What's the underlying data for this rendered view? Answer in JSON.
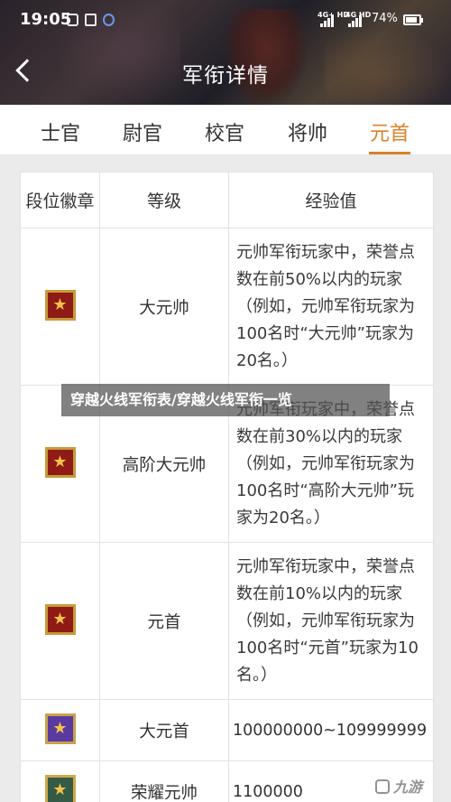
{
  "status_bar": {
    "time": "19:05",
    "network_1": "4G+ HD",
    "network_2": "4G HD",
    "battery": "74%"
  },
  "header": {
    "title": "军衔详情",
    "back_icon": "chevron-left-icon"
  },
  "tabs": [
    {
      "label": "士官",
      "active": false
    },
    {
      "label": "尉官",
      "active": false
    },
    {
      "label": "校官",
      "active": false
    },
    {
      "label": "将帅",
      "active": false
    },
    {
      "label": "元首",
      "active": true
    }
  ],
  "accent_color": "#d9822b",
  "table": {
    "columns": [
      "段位徽章",
      "等级",
      "经验值"
    ],
    "rows": [
      {
        "badge_icon": "rank-badge-red-star-icon",
        "level": "大元帅",
        "exp": "元帅军衔玩家中，荣誉点数在前50%以内的玩家（例如，元帅军衔玩家为100名时“大元帅”玩家为20名。）"
      },
      {
        "badge_icon": "rank-badge-red-laurel-icon",
        "level": "高阶大元帅",
        "exp": "元帅军衔玩家中，荣誉点数在前30%以内的玩家（例如，元帅军衔玩家为100名时“高阶大元帅”玩家为20名。）"
      },
      {
        "badge_icon": "rank-badge-red-crest-icon",
        "level": "元首",
        "exp": "元帅军衔玩家中，荣誉点数在前10%以内的玩家（例如，元帅军衔玩家为100名时“元首”玩家为10名。）"
      },
      {
        "badge_icon": "rank-badge-purple-star-icon",
        "level": "大元首",
        "exp": "100000000~109999999"
      },
      {
        "badge_icon": "rank-badge-green-emblem-icon",
        "level": "荣耀元帅",
        "exp": "1100000"
      }
    ]
  },
  "overlay_caption": "穿越火线军衔表/穿越火线军衔一览",
  "watermark": "九游"
}
